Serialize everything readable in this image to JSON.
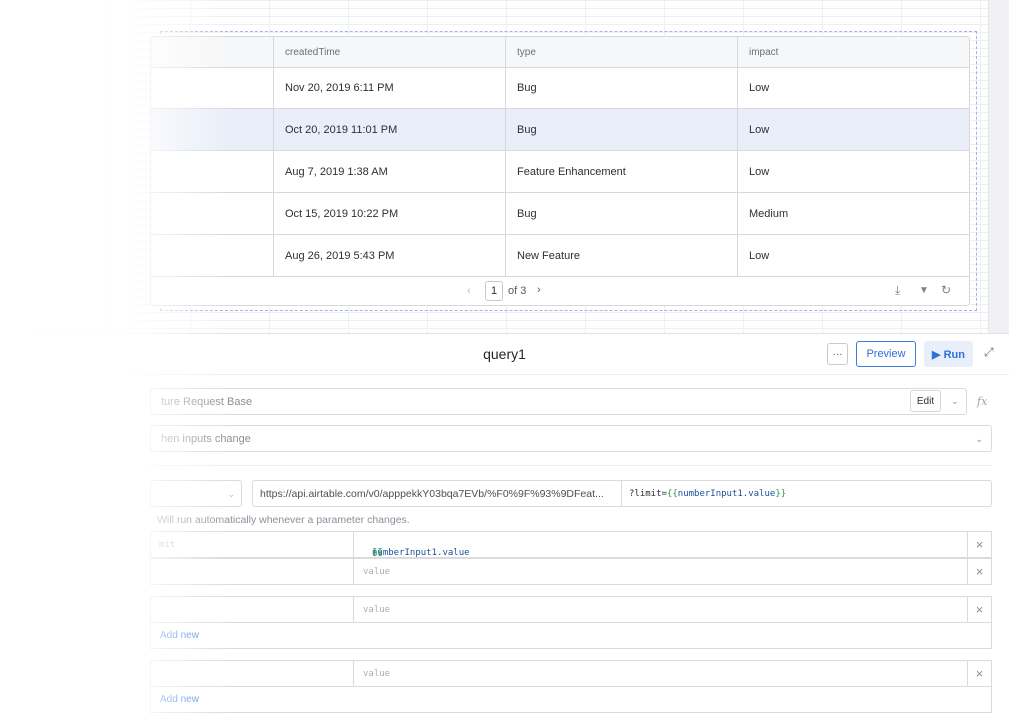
{
  "table": {
    "columns": [
      "createdTime",
      "type",
      "impact"
    ],
    "rows": [
      {
        "createdTime": "Nov 20, 2019 6:11 PM",
        "type": "Bug",
        "impact": "Low",
        "selected": false
      },
      {
        "createdTime": "Oct 20, 2019 11:01 PM",
        "type": "Bug",
        "impact": "Low",
        "selected": true
      },
      {
        "createdTime": "Aug 7, 2019 1:38 AM",
        "type": "Feature Enhancement",
        "impact": "Low",
        "selected": false
      },
      {
        "createdTime": "Oct 15, 2019 10:22 PM",
        "type": "Bug",
        "impact": "Medium",
        "selected": false
      },
      {
        "createdTime": "Aug 26, 2019 5:43 PM",
        "type": "New Feature",
        "impact": "Low",
        "selected": false
      }
    ],
    "pagination": {
      "prev": "‹",
      "current_page": "1",
      "of_text": "of 3",
      "next": "›"
    },
    "tools": {
      "download": "⤓",
      "filter": "▼",
      "refresh": "↻"
    }
  },
  "query": {
    "title": "query1",
    "more_label": "···",
    "preview_label": "Preview",
    "run_label": "▶ Run",
    "expand_icon": "⤢",
    "resource_label": "ture Request Base",
    "edit_label": "Edit",
    "edit_chevron": "⌄",
    "fx_label": "fx",
    "trigger_label": "hen inputs change",
    "trigger_chevron": "⌄",
    "method_chevron": "⌄",
    "url_base": "https://api.airtable.com/v0/apppekkY03bqa7EVb/%F0%9F%93%9DFeat...",
    "url_qs_prefix": "?limit=",
    "tpl_open": "{{",
    "tpl_var": "numberInput1.value",
    "tpl_close": "}}",
    "hint": "Will run automatically whenever a parameter changes.",
    "params": [
      {
        "key": "mit",
        "value_ph": ""
      },
      {
        "key": "",
        "value_ph": "value"
      }
    ],
    "params2": [
      {
        "key": "",
        "value_ph": "value"
      }
    ],
    "params3": [
      {
        "key": "",
        "value_ph": "value"
      }
    ],
    "add_new_label": "Add new",
    "delete_icon": "×"
  }
}
